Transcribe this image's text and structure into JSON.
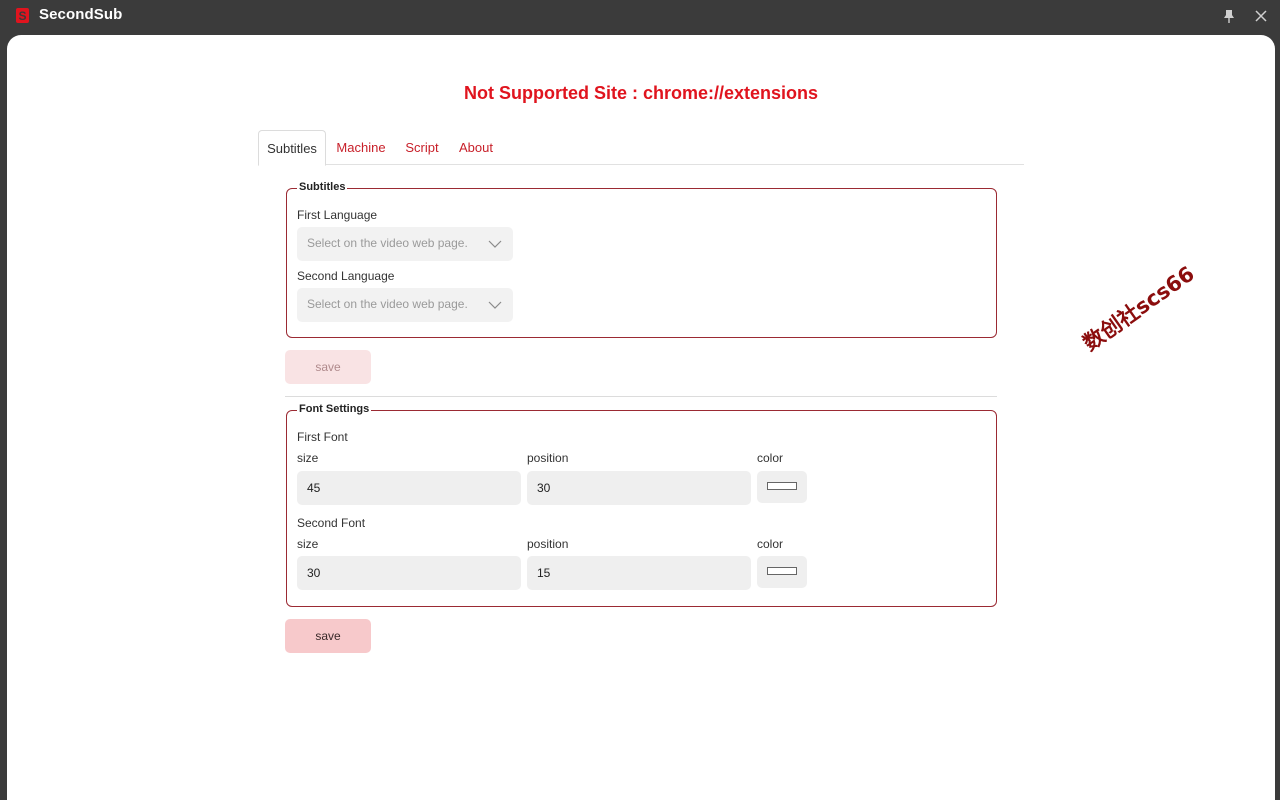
{
  "app": {
    "title": "SecondSub",
    "logo_letter": "S",
    "brand_color": "#e0141e"
  },
  "titlebar": {
    "pin_icon": "pin-icon",
    "close_icon": "close-icon"
  },
  "warning": "Not Supported Site : chrome://extensions",
  "tabs": [
    {
      "label": "Subtitles",
      "active": true
    },
    {
      "label": "Machine",
      "active": false
    },
    {
      "label": "Script",
      "active": false
    },
    {
      "label": "About",
      "active": false
    }
  ],
  "subtitles_section": {
    "legend": "Subtitles",
    "first_language": {
      "label": "First Language",
      "placeholder": "Select on the video web page."
    },
    "second_language": {
      "label": "Second Language",
      "placeholder": "Select on the video web page."
    },
    "save_label": "save"
  },
  "font_section": {
    "legend": "Font Settings",
    "first_font": {
      "heading": "First Font",
      "size_label": "size",
      "size_value": "45",
      "position_label": "position",
      "position_value": "30",
      "color_label": "color",
      "color_value": "#ffffff"
    },
    "second_font": {
      "heading": "Second Font",
      "size_label": "size",
      "size_value": "30",
      "position_label": "position",
      "position_value": "15",
      "color_label": "color",
      "color_value": "#ffffff"
    },
    "save_label": "save"
  },
  "watermark": "数创社scs66"
}
